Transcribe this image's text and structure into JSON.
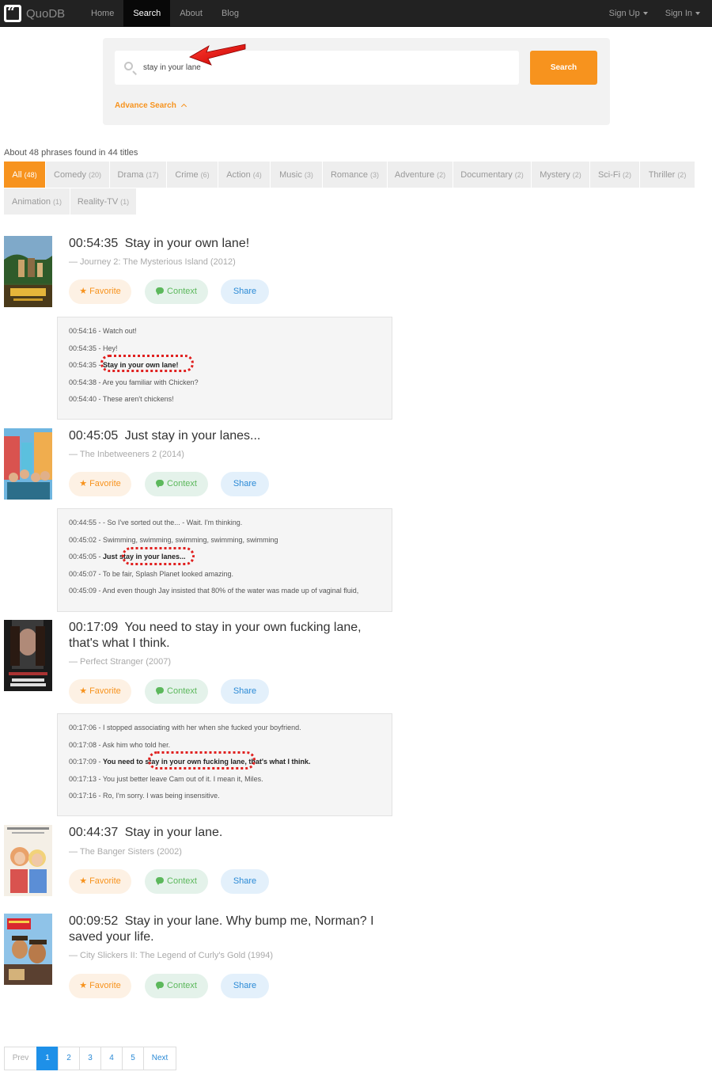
{
  "nav": {
    "brand": "QuoDB",
    "links": [
      "Home",
      "Search",
      "About",
      "Blog"
    ],
    "active": "Search",
    "sign_up": "Sign Up",
    "sign_in": "Sign In"
  },
  "search": {
    "value": "stay in your lane",
    "button": "Search",
    "advance": "Advance Search"
  },
  "result_count": "About 48 phrases found in 44 titles",
  "genres": [
    {
      "label": "All",
      "count": "(48)"
    },
    {
      "label": "Comedy",
      "count": "(20)"
    },
    {
      "label": "Drama",
      "count": "(17)"
    },
    {
      "label": "Crime",
      "count": "(6)"
    },
    {
      "label": "Action",
      "count": "(4)"
    },
    {
      "label": "Music",
      "count": "(3)"
    },
    {
      "label": "Romance",
      "count": "(3)"
    },
    {
      "label": "Adventure",
      "count": "(2)"
    },
    {
      "label": "Documentary",
      "count": "(2)"
    },
    {
      "label": "Mystery",
      "count": "(2)"
    },
    {
      "label": "Sci-Fi",
      "count": "(2)"
    },
    {
      "label": "Thriller",
      "count": "(2)"
    },
    {
      "label": "Animation",
      "count": "(1)"
    },
    {
      "label": "Reality-TV",
      "count": "(1)"
    }
  ],
  "buttons": {
    "favorite": "Favorite",
    "context": "Context",
    "share": "Share"
  },
  "results": [
    {
      "time": "00:54:35",
      "phrase": "Stay in your own lane!",
      "movie": "— Journey 2: The Mysterious Island (2012)",
      "context": [
        {
          "time": "00:54:16 - ",
          "text": "Watch out!"
        },
        {
          "time": "00:54:35 - ",
          "text": "Hey!"
        },
        {
          "time": "00:54:35 - ",
          "text": "Stay in your own lane!",
          "bold": true
        },
        {
          "time": "00:54:38 - ",
          "text": "Are you familiar with Chicken?"
        },
        {
          "time": "00:54:40 - ",
          "text": "These aren't chickens!"
        }
      ]
    },
    {
      "time": "00:45:05",
      "phrase": "Just stay in your lanes...",
      "movie": "— The Inbetweeners 2 (2014)",
      "context": [
        {
          "time": "00:44:55 - ",
          "text": "- So I've sorted out the... - Wait. I'm thinking."
        },
        {
          "time": "00:45:02 - ",
          "text": "Swimming, swimming, swimming, swimming, swimming"
        },
        {
          "time": "00:45:05 - ",
          "text": "Just stay in your lanes...",
          "bold": true
        },
        {
          "time": "00:45:07 - ",
          "text": "To be fair, Splash Planet looked amazing."
        },
        {
          "time": "00:45:09 - ",
          "text": "And even though Jay insisted that 80% of the water was made up of vaginal fluid,"
        }
      ]
    },
    {
      "time": "00:17:09",
      "phrase": "You need to stay in your own fucking lane, that's what I think.",
      "movie": "— Perfect Stranger (2007)",
      "context": [
        {
          "time": "00:17:06 - ",
          "text": "I stopped associating with her when she fucked your boyfriend."
        },
        {
          "time": "00:17:08 - ",
          "text": "Ask him who told her."
        },
        {
          "time": "00:17:09 - ",
          "text": "You need to stay in your own fucking lane, that's what I think.",
          "bold": true
        },
        {
          "time": "00:17:13 - ",
          "text": "You just better leave Cam out of it. I mean it, Miles."
        },
        {
          "time": "00:17:16 - ",
          "text": "Ro, I'm sorry. I was being insensitive."
        }
      ]
    },
    {
      "time": "00:44:37",
      "phrase": "Stay in your lane.",
      "movie": "— The Banger Sisters (2002)"
    },
    {
      "time": "00:09:52",
      "phrase": "Stay in your lane. Why bump me, Norman? I saved your life.",
      "movie": "— City Slickers II: The Legend of Curly's Gold (1994)"
    }
  ],
  "pagination": {
    "prev": "Prev",
    "pages": [
      "1",
      "2",
      "3",
      "4",
      "5"
    ],
    "active": "1",
    "next": "Next"
  },
  "colors": {
    "accent": "#f7931e",
    "nav_bg": "#222222",
    "link_blue": "#2b8ad6",
    "highlight_ring": "#e0201f"
  }
}
